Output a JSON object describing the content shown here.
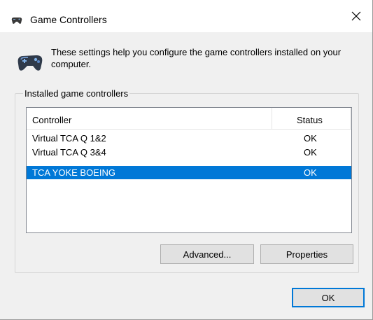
{
  "window": {
    "title": "Game Controllers",
    "close_label": "✕"
  },
  "intro": {
    "text": "These settings help you configure the game controllers installed on your computer."
  },
  "group": {
    "label": "Installed game controllers"
  },
  "list": {
    "columns": [
      "Controller",
      "Status"
    ],
    "rows": [
      {
        "name": "Virtual TCA Q 1&2",
        "status": "OK",
        "selected": false
      },
      {
        "name": "Virtual TCA Q 3&4",
        "status": "OK",
        "selected": false
      },
      {
        "name": "TCA YOKE BOEING",
        "status": "OK",
        "selected": true
      }
    ]
  },
  "buttons": {
    "advanced": "Advanced...",
    "properties": "Properties",
    "ok": "OK"
  },
  "colors": {
    "selection": "#0078d7",
    "background": "#f0f0f0",
    "button": "#e1e1e1"
  },
  "icons": {
    "title": "gamepad-icon",
    "intro": "gamepad-icon",
    "close": "close-icon"
  }
}
